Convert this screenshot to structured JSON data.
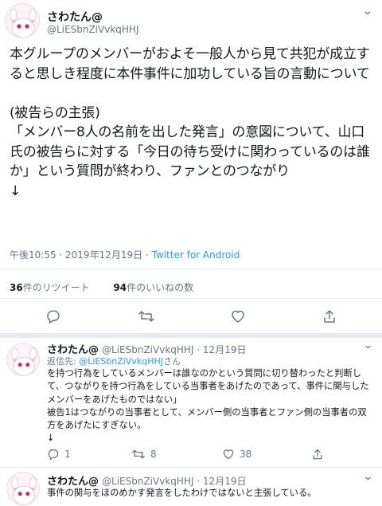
{
  "main_tweet": {
    "display_name": "さわたん@",
    "handle": "@LiESbnZiVvkqHHJ",
    "text": "本グループのメンバーがおよそ一般人から見て共犯が成立すると思しき程度に本件事件に加功している旨の言動について\n\n(被告らの主張)\n「メンバー8人の名前を出した発言」の意図について、山口氏の被告らに対する「今日の待ち受けに関わっているのは誰か」という質問が終わり、ファンとのつながり\n↓",
    "timestamp": "午後10:55 · 2019年12月19日 · ",
    "source": "Twitter for Android",
    "retweets_count": "36",
    "retweets_label": "件のリツイート",
    "likes_count": "94",
    "likes_label": "件のいいねの数"
  },
  "replies": [
    {
      "display_name": "さわたん@",
      "handle_date": "@LiESbnZiVvkqHHJ · 12月19日",
      "replying_prefix": "返信先: ",
      "replying_to": "@LiESbnZiVvkqHHJ",
      "replying_suffix": "さん",
      "text": "を持つ行為をしているメンバーは誰なのかという質問に切り替わったと判断して、つながりを持つ行為をしている当事者をあげたのであって、事件に関与したメンバーをあげたものではない」\n被告1はつながりの当事者として、メンバー側の当事者とファン側の当事者の双方をあげたにすぎない。\n↓",
      "reply_count": "1",
      "retweet_count": "8",
      "like_count": "38"
    },
    {
      "display_name": "さわたん@",
      "handle_date": "@LiESbnZiVvkqHHJ · 12月19日",
      "text": "事件の関与をほのめかす発言をしたわけではないと主張している。"
    }
  ],
  "icons": {
    "caret": "chevron-down-icon",
    "reply": "reply-icon",
    "retweet": "retweet-icon",
    "like": "heart-icon",
    "share": "share-icon"
  },
  "colors": {
    "accent": "#1da1f2",
    "muted": "#657786",
    "text": "#14171a",
    "divider": "#e6ecf0"
  }
}
